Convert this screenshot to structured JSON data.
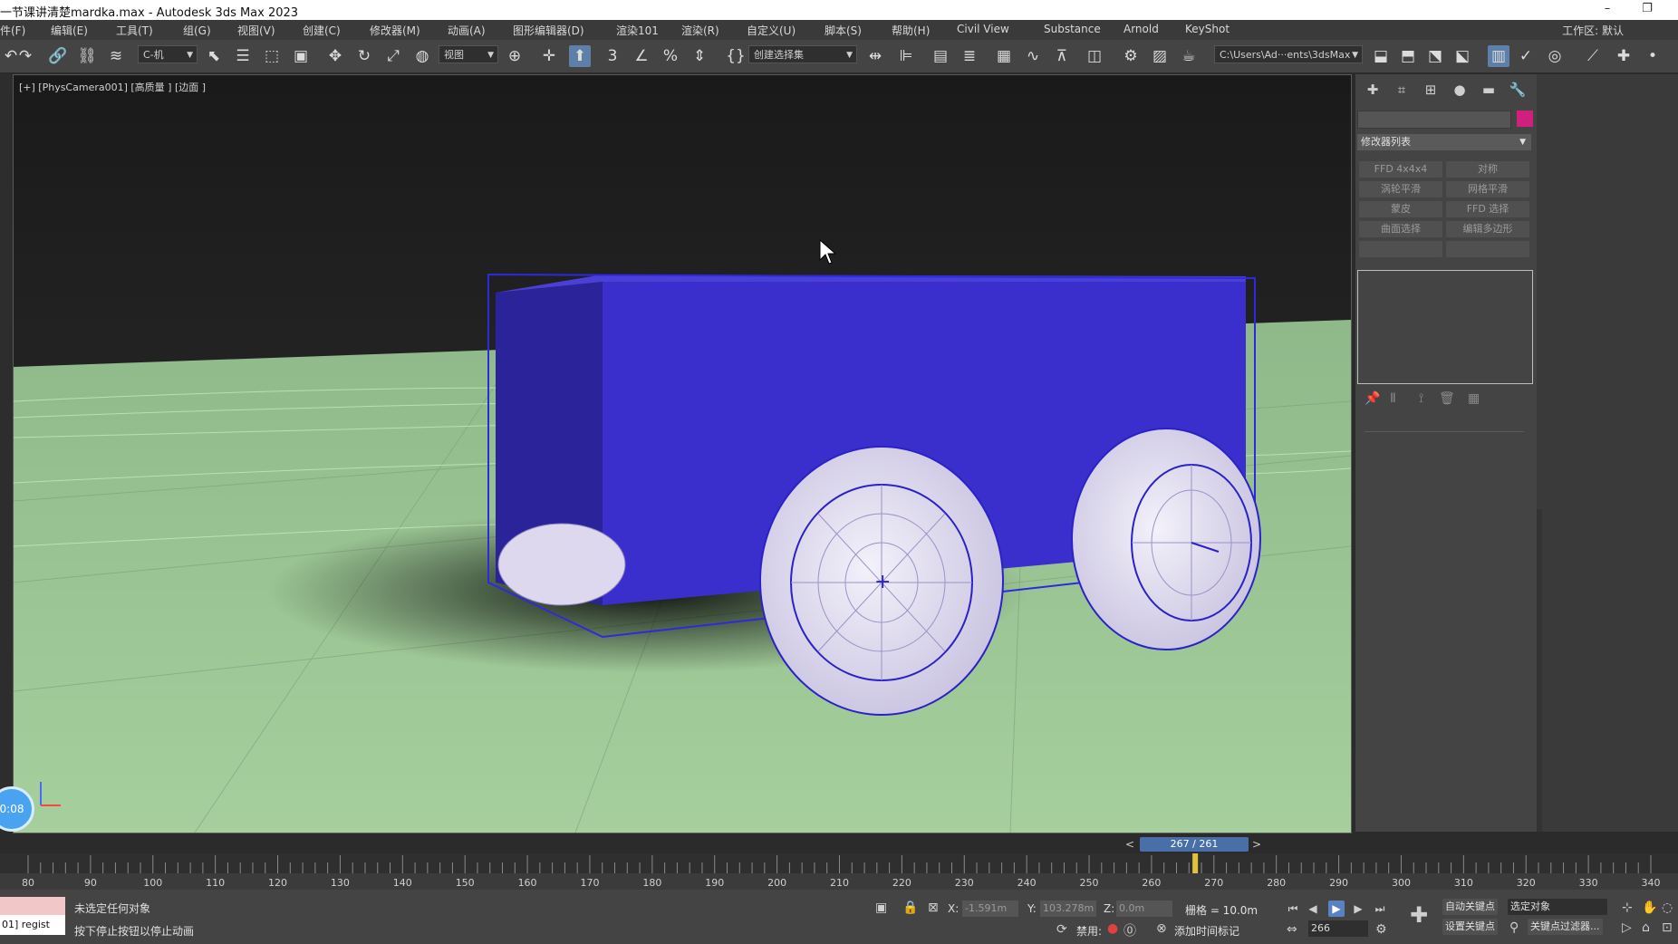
{
  "window": {
    "title": "一节课讲清楚mardka.max - Autodesk 3ds Max 2023",
    "minimize": "–",
    "restore": "❐"
  },
  "menu": {
    "items": [
      "件(F)",
      "编辑(E)",
      "工具(T)",
      "组(G)",
      "视图(V)",
      "创建(C)",
      "修改器(M)",
      "动画(A)",
      "图形编辑器(D)",
      "渲染101",
      "渲染(R)",
      "自定义(U)",
      "脚本(S)",
      "帮助(H)",
      "Civil View",
      "Substance",
      "Arnold",
      "KeyShot"
    ],
    "workspace_label": "工作区:",
    "workspace_value": "默认"
  },
  "toolbar": {
    "filter_dropdown": "C-机",
    "ref_coord_dropdown": "视图",
    "named_selection_dropdown": "创建选择集",
    "project_path": "C:\\Users\\Ad···ents\\3dsMax",
    "percent_label": "%"
  },
  "viewport": {
    "label": "[+] [PhysCamera001] [高质量 ] [边面 ]",
    "box_color": "#3a2fcc",
    "ground_color": "#a7cfa0",
    "wheel_color": "#e9e5f6"
  },
  "command_panel": {
    "color_swatch": "#d0207e",
    "modifier_list": "修改器列表",
    "buttons": [
      "FFD 4x4x4",
      "对称",
      "涡轮平滑",
      "网格平滑",
      "蒙皮",
      "FFD 选择",
      "曲面选择",
      "编辑多边形",
      "",
      ""
    ]
  },
  "time_slider": {
    "value": "267 / 261",
    "prev": "<",
    "next": ">"
  },
  "timeline": {
    "ticks": [
      80,
      90,
      100,
      110,
      120,
      130,
      140,
      150,
      160,
      170,
      180,
      190,
      200,
      210,
      220,
      230,
      240,
      250,
      260,
      270,
      280,
      290,
      300,
      310,
      320,
      330,
      340
    ],
    "current_frame": 267
  },
  "status": {
    "script_value": "01] regist",
    "selection": "未选定任何对象",
    "prompt": "按下停止按钮以停止动画",
    "x_label": "X:",
    "x_value": "-1.591m",
    "y_label": "Y:",
    "y_value": "103.278m",
    "z_label": "Z:",
    "z_value": "0.0m",
    "grid": "栅格 = 10.0m",
    "disable_label": "禁用:",
    "add_time_tag": "添加时间标记",
    "auto_key": "自动关键点",
    "set_key": "设置关键点",
    "selected_object": "选定对象",
    "key_filters": "关键点过滤器...",
    "frame_field": "266"
  },
  "overlay": {
    "timer": "0:08"
  }
}
